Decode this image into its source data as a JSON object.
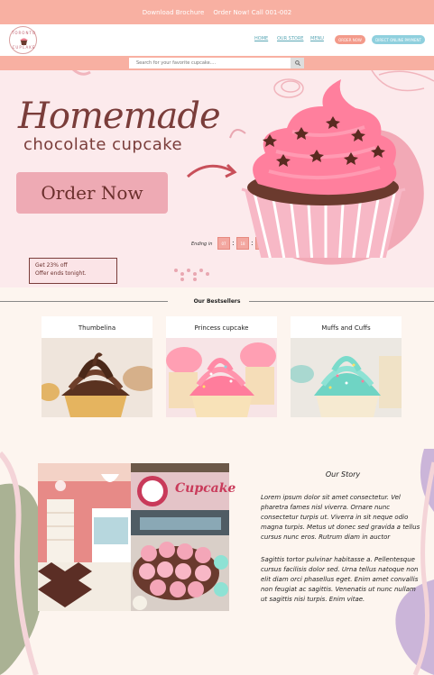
{
  "topbar": {
    "brochure": "Download Brochure",
    "order_call": "Order Now! Call 001-002"
  },
  "header": {
    "logo_top": "TORONTO",
    "logo_bottom": "CUPCAKE",
    "nav": [
      "HOME",
      "OUR STORE",
      "MENU"
    ],
    "order_button": "ORDER NOW",
    "pay_button": "DIRECT ONLINE PAYMENT"
  },
  "search": {
    "placeholder": "Search for your favorite cupcake...."
  },
  "hero": {
    "title": "Homemade",
    "subtitle": "chocolate cupcake",
    "order_button": "Order Now",
    "offer_line1": "Get 23% off",
    "offer_line2": "Offer ends tonight.",
    "ending_label": "Ending in",
    "timer": [
      "07",
      "18",
      "48"
    ]
  },
  "bestsellers": {
    "title": "Our Bestsellers",
    "items": [
      {
        "name": "Thumbelina"
      },
      {
        "name": "Princess cupcake"
      },
      {
        "name": "Muffs and Cuffs"
      }
    ]
  },
  "story": {
    "title": "Our Story",
    "sign_text": "Cupcake",
    "para1": "Lorem ipsum dolor sit amet consectetur. Vel pharetra fames nisl viverra. Ornare nunc consectetur turpis ut. Viverra in sit neque odio magna turpis. Metus ut donec sed gravida a tellus cursus nunc eros. Rutrum diam in auctor",
    "para2": "Sagittis tortor pulvinar habitasse a. Pellentesque cursus facilisis dolor sed. Urna tellus natoque non elit diam orci phasellus eget. Enim amet convallis non feugiat ac sagittis. Venenatis ut nunc nullam ut sagittis nisi turpis. Enim vitae."
  },
  "colors": {
    "accent_pink": "#f8b0a2",
    "teal": "#5aa7b5",
    "hero_bg": "#fceaec",
    "brown": "#7a3d3a"
  }
}
